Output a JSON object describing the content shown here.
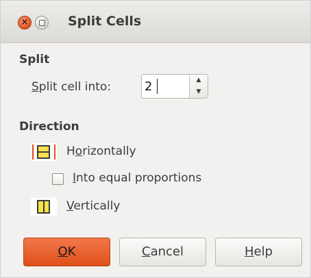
{
  "window": {
    "title": "Split Cells",
    "close_glyph": "×"
  },
  "split_section": {
    "title": "Split",
    "split_label_accesskey": "S",
    "split_label_rest": "plit cell into:",
    "split_value": "2"
  },
  "direction_section": {
    "title": "Direction",
    "horizontally": {
      "pre": "H",
      "accesskey": "o",
      "rest": "rizontally",
      "icon": "split-horizontal-icon"
    },
    "equal_proportions": {
      "accesskey": "I",
      "rest": "nto equal proportions",
      "checked": false
    },
    "vertically": {
      "accesskey": "V",
      "rest": "ertically",
      "icon": "split-vertical-icon"
    }
  },
  "buttons": {
    "ok": {
      "accesskey": "O",
      "rest": "K"
    },
    "cancel": {
      "accesskey": "C",
      "rest": "ancel"
    },
    "help": {
      "accesskey": "H",
      "rest": "elp"
    }
  },
  "colors": {
    "accent": "#df4f1a",
    "icon_fill": "#f6e24a",
    "window_bg": "#f2f1f0"
  }
}
